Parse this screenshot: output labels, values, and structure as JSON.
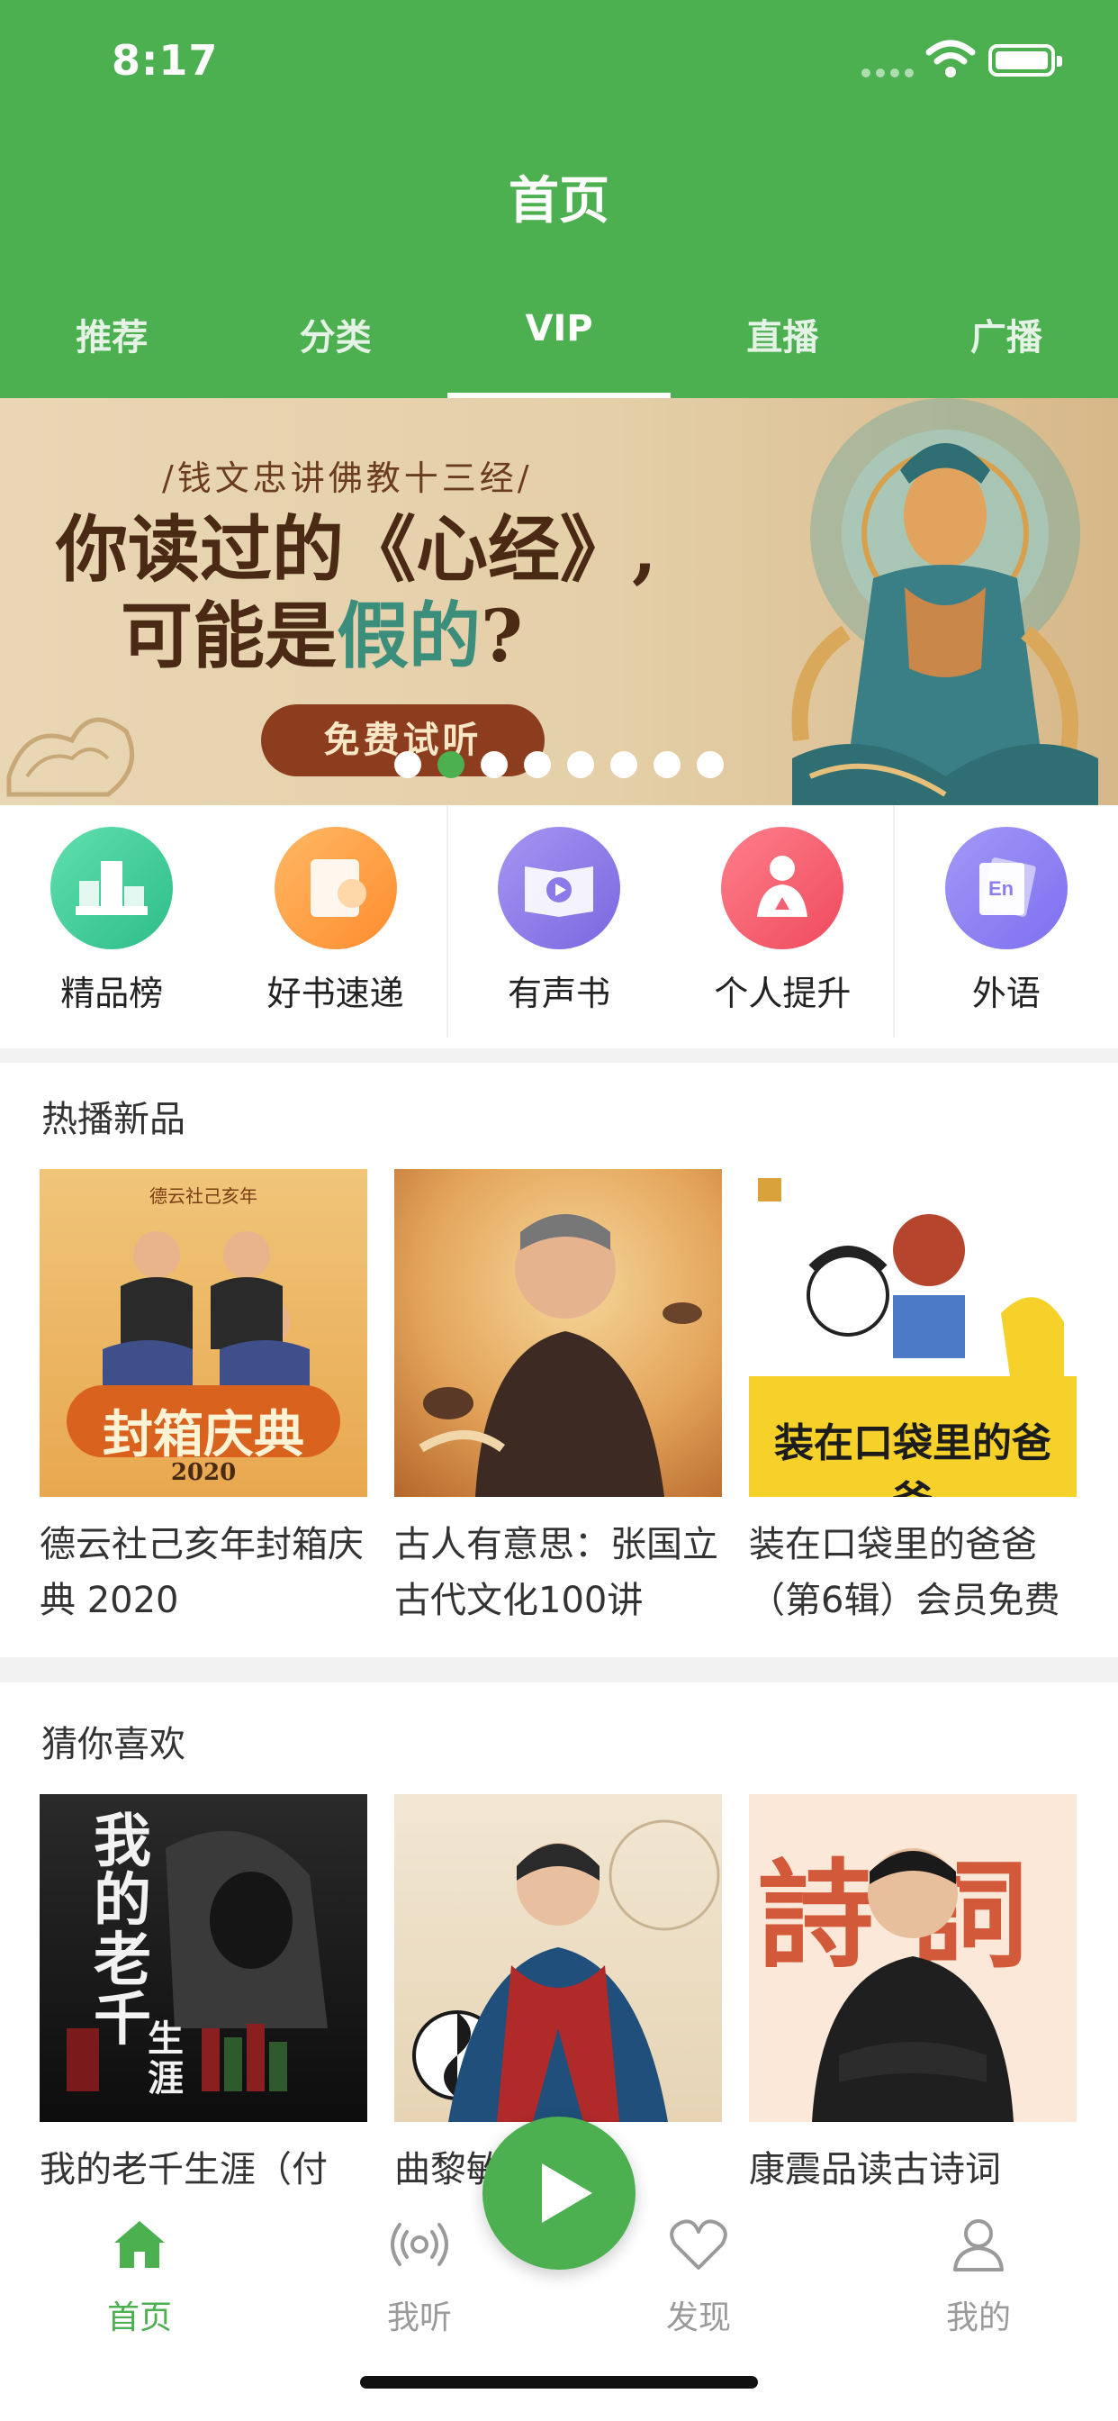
{
  "status_bar": {
    "time": "8:17"
  },
  "header": {
    "title": "首页"
  },
  "tabs": [
    {
      "label": "推荐"
    },
    {
      "label": "分类"
    },
    {
      "label": "VIP",
      "active": true
    },
    {
      "label": "直播"
    },
    {
      "label": "广播"
    }
  ],
  "banner": {
    "series": "/钱文忠讲佛教十三经/",
    "headline_line1": "你读过的《心经》,",
    "headline_line2_pre": "可能是",
    "headline_line2_accent": "假的",
    "headline_line2_post": "?",
    "cta": "免费试听",
    "dot_count": 8,
    "active_dot": 1
  },
  "categories": [
    {
      "label": "精品榜",
      "icon": "trophy-icon",
      "color": "#3cc794"
    },
    {
      "label": "好书速递",
      "icon": "book-delivery-icon",
      "color": "#ffa142"
    },
    {
      "label": "有声书",
      "icon": "audiobook-icon",
      "color": "#8b7ae8"
    },
    {
      "label": "个人提升",
      "icon": "person-up-icon",
      "color": "#f55a6a"
    },
    {
      "label": "外语",
      "icon": "language-icon",
      "color": "#8c7ff2"
    }
  ],
  "hot_new": {
    "title": "热播新品",
    "items": [
      {
        "title": "德云社己亥年封箱庆典 2020",
        "cover_text": "封箱庆典",
        "cover_sub": "2020",
        "cover_top": "德云社己亥年"
      },
      {
        "title": "古人有意思：张国立古代文化100讲"
      },
      {
        "title": "装在口袋里的爸爸（第6辑）会员免费",
        "cover_text": "装在口袋里的爸爸"
      }
    ]
  },
  "guess": {
    "title": "猜你喜欢",
    "items": [
      {
        "title": "我的老千生涯（付",
        "cover_text": "我的老千",
        "cover_sub": "生涯"
      },
      {
        "title": "曲黎敏《黄"
      },
      {
        "title": "康震品读古诗词",
        "cover_text": "詩詞"
      }
    ]
  },
  "bottom_nav": [
    {
      "label": "首页",
      "icon": "home-icon",
      "active": true
    },
    {
      "label": "我听",
      "icon": "listen-icon"
    },
    {
      "label": "发现",
      "icon": "heart-icon"
    },
    {
      "label": "我的",
      "icon": "profile-icon"
    }
  ],
  "colors": {
    "brand": "#4caf50"
  }
}
